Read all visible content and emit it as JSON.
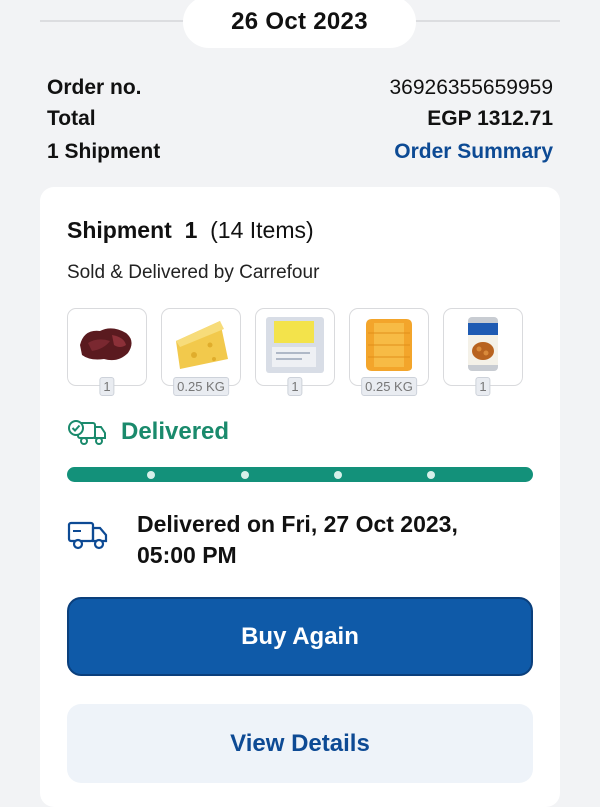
{
  "header": {
    "date": "26 Oct 2023"
  },
  "order": {
    "order_no_label": "Order no.",
    "order_no": "36926355659959",
    "total_label": "Total",
    "total": "EGP 1312.71",
    "shipments_label": "1 Shipment",
    "summary_link": "Order Summary"
  },
  "shipment": {
    "title": "Shipment",
    "number": "1",
    "items_count": "(14  Items)",
    "seller": "Sold & Delivered by Carrefour",
    "items": [
      {
        "icon": "liver-icon",
        "qty": "1"
      },
      {
        "icon": "cheese-wedge-icon",
        "qty": "0.25 KG"
      },
      {
        "icon": "packaged-product-icon",
        "qty": "1"
      },
      {
        "icon": "cheese-slices-icon",
        "qty": "0.25 KG"
      },
      {
        "icon": "canned-beans-icon",
        "qty": "1"
      }
    ],
    "status": "Delivered",
    "progress": 1.0,
    "delivered_on": "Delivered on Fri, 27 Oct 2023, 05:00 PM",
    "buy_again": "Buy Again",
    "view_details": "View Details"
  },
  "colors": {
    "primary": "#0f5aa8",
    "success": "#13917a",
    "link": "#0d4a94"
  }
}
